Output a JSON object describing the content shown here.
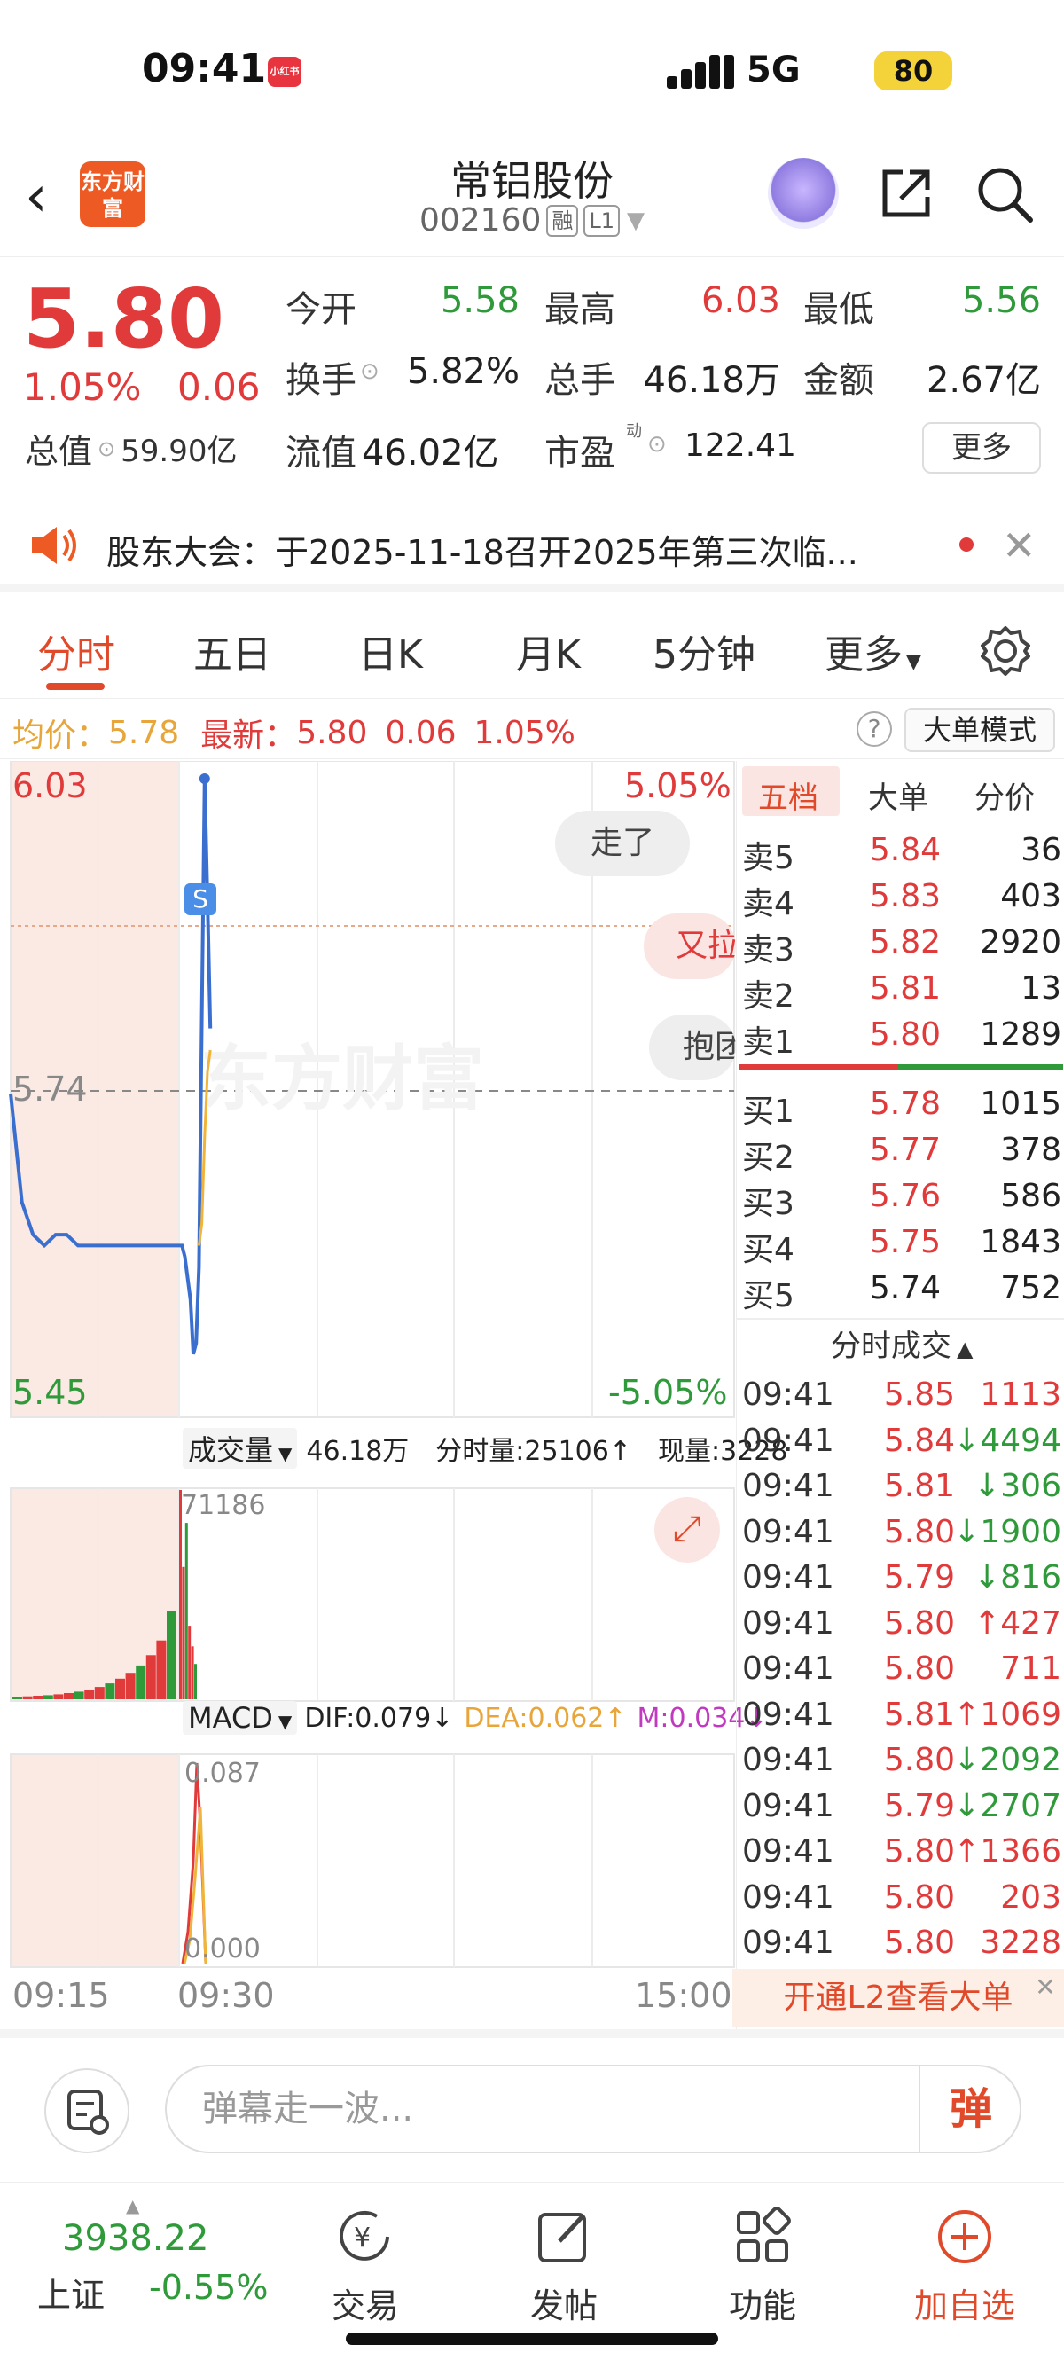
{
  "status_bar": {
    "time": "09:41",
    "app_badge": "小红书",
    "network": "5G",
    "battery": "80"
  },
  "header": {
    "back_icon": "chevron-left-icon",
    "logo_text": "东方财富",
    "stock_name": "常铝股份",
    "stock_code": "002160",
    "tag_margin": "融",
    "tag_level": "L1"
  },
  "quote": {
    "price": "5.80",
    "change_pct": "1.05%",
    "change": "0.06",
    "open_label": "今开",
    "open": "5.58",
    "high_label": "最高",
    "high": "6.03",
    "low_label": "最低",
    "low": "5.56",
    "turnover_label": "换手",
    "turnover": "5.82%",
    "volume_label": "总手",
    "volume": "46.18万",
    "amount_label": "金额",
    "amount": "2.67亿",
    "mcap_label": "总值",
    "mcap": "59.90亿",
    "float_label": "流值",
    "float_val": "46.02亿",
    "pe_label": "市盈",
    "pe_sup": "动",
    "pe": "122.41",
    "more": "更多"
  },
  "announcement": {
    "text": "股东大会：于2025-11-18召开2025年第三次临..."
  },
  "tabs": [
    "分时",
    "五日",
    "日K",
    "月K",
    "5分钟",
    "更多"
  ],
  "avg_bar": {
    "avg_label": "均价：",
    "avg": "5.78",
    "latest_label": "最新：",
    "latest": "5.80",
    "latest_chg": "0.06",
    "latest_pct": "1.05%",
    "big_mode": "大单模式"
  },
  "chart": {
    "price_top": "6.03",
    "price_mid": "5.74",
    "price_bottom": "5.45",
    "pct_top": "5.05%",
    "pct_bottom": "-5.05%",
    "s_marker": "S",
    "watermark": "东方财富",
    "bubbles": [
      "走了",
      "又拉",
      "抱团"
    ],
    "volume_selector": "成交量",
    "volume_total": "46.18万",
    "volume_split": "分时量:25106↑",
    "volume_now": "现量:3228",
    "volume_max": "71186",
    "macd_selector": "MACD",
    "dif": "DIF:0.079↓",
    "dea": "DEA:0.062↑",
    "m": "M:0.034↓",
    "macd_max": "0.087",
    "macd_min": "0.000",
    "times": [
      "09:15",
      "09:30",
      "15:00"
    ]
  },
  "chart_data": {
    "type": "line",
    "series": [
      {
        "name": "价格",
        "x": [
          "09:15",
          "09:16",
          "09:17",
          "09:18",
          "09:19",
          "09:20",
          "09:21",
          "09:22",
          "09:23",
          "09:24",
          "09:25",
          "09:26",
          "09:27",
          "09:28",
          "09:29",
          "09:30",
          "09:31",
          "09:32",
          "09:33",
          "09:34",
          "09:35",
          "09:36",
          "09:37",
          "09:38",
          "09:39",
          "09:40",
          "09:41"
        ],
        "values": [
          5.74,
          5.64,
          5.61,
          5.6,
          5.61,
          5.61,
          5.6,
          5.6,
          5.6,
          5.6,
          5.6,
          5.6,
          5.6,
          5.6,
          5.6,
          5.6,
          5.6,
          5.59,
          5.57,
          5.55,
          5.5,
          5.51,
          5.58,
          5.81,
          6.03,
          5.92,
          5.8
        ]
      },
      {
        "name": "均价",
        "x": [
          "09:37",
          "09:38",
          "09:39",
          "09:40",
          "09:41"
        ],
        "values": [
          5.6,
          5.62,
          5.7,
          5.76,
          5.78
        ]
      }
    ],
    "ylim": [
      5.45,
      6.03
    ],
    "volume_values": [
      900,
      1000,
      1200,
      1400,
      1700,
      2100,
      2600,
      3300,
      4200,
      5400,
      7000,
      9000,
      11500,
      15000,
      20000,
      30000,
      71186,
      45000,
      60000,
      25000,
      18000,
      12000
    ],
    "volume_ylim": [
      0,
      71186
    ],
    "macd_ylim": [
      0.0,
      0.087
    ]
  },
  "order_book": {
    "tabs": [
      "五档",
      "大单",
      "分价"
    ],
    "asks": [
      {
        "label": "卖5",
        "price": "5.84",
        "vol": "36"
      },
      {
        "label": "卖4",
        "price": "5.83",
        "vol": "403"
      },
      {
        "label": "卖3",
        "price": "5.82",
        "vol": "2920"
      },
      {
        "label": "卖2",
        "price": "5.81",
        "vol": "13"
      },
      {
        "label": "卖1",
        "price": "5.80",
        "vol": "1289"
      }
    ],
    "bids": [
      {
        "label": "买1",
        "price": "5.78",
        "vol": "1015"
      },
      {
        "label": "买2",
        "price": "5.77",
        "vol": "378"
      },
      {
        "label": "买3",
        "price": "5.76",
        "vol": "586"
      },
      {
        "label": "买4",
        "price": "5.75",
        "vol": "1843"
      },
      {
        "label": "买5",
        "price": "5.74",
        "vol": "752"
      }
    ]
  },
  "trades": {
    "title": "分时成交",
    "rows": [
      {
        "time": "09:41",
        "price": "5.85",
        "vol": "1113",
        "dir": ""
      },
      {
        "time": "09:41",
        "price": "5.84",
        "vol": "4494",
        "dir": "↓"
      },
      {
        "time": "09:41",
        "price": "5.81",
        "vol": "306",
        "dir": "↓"
      },
      {
        "time": "09:41",
        "price": "5.80",
        "vol": "1900",
        "dir": "↓"
      },
      {
        "time": "09:41",
        "price": "5.79",
        "vol": "816",
        "dir": "↓"
      },
      {
        "time": "09:41",
        "price": "5.80",
        "vol": "427",
        "dir": "↑"
      },
      {
        "time": "09:41",
        "price": "5.80",
        "vol": "711",
        "dir": ""
      },
      {
        "time": "09:41",
        "price": "5.81",
        "vol": "1069",
        "dir": "↑"
      },
      {
        "time": "09:41",
        "price": "5.80",
        "vol": "2092",
        "dir": "↓"
      },
      {
        "time": "09:41",
        "price": "5.79",
        "vol": "2707",
        "dir": "↓"
      },
      {
        "time": "09:41",
        "price": "5.80",
        "vol": "1366",
        "dir": "↑"
      },
      {
        "time": "09:41",
        "price": "5.80",
        "vol": "203",
        "dir": ""
      },
      {
        "time": "09:41",
        "price": "5.80",
        "vol": "3228",
        "dir": ""
      }
    ],
    "l2_promo": "开通L2查看大单"
  },
  "comment": {
    "placeholder": "弹幕走一波...",
    "danmu": "弹"
  },
  "bottom_bar": {
    "index_value": "3938.22",
    "index_name": "上证",
    "index_change": "-0.55%",
    "nav": [
      {
        "label": "交易",
        "icon": "trade-icon"
      },
      {
        "label": "发帖",
        "icon": "post-icon"
      },
      {
        "label": "功能",
        "icon": "grid-icon"
      },
      {
        "label": "加自选",
        "icon": "add-circle-icon"
      }
    ]
  },
  "colors": {
    "up": "#e03a3a",
    "down": "#2f9a3a",
    "accent": "#e04a2a",
    "price_line": "#3a6fd0",
    "avg_line": "#f0b43a"
  }
}
